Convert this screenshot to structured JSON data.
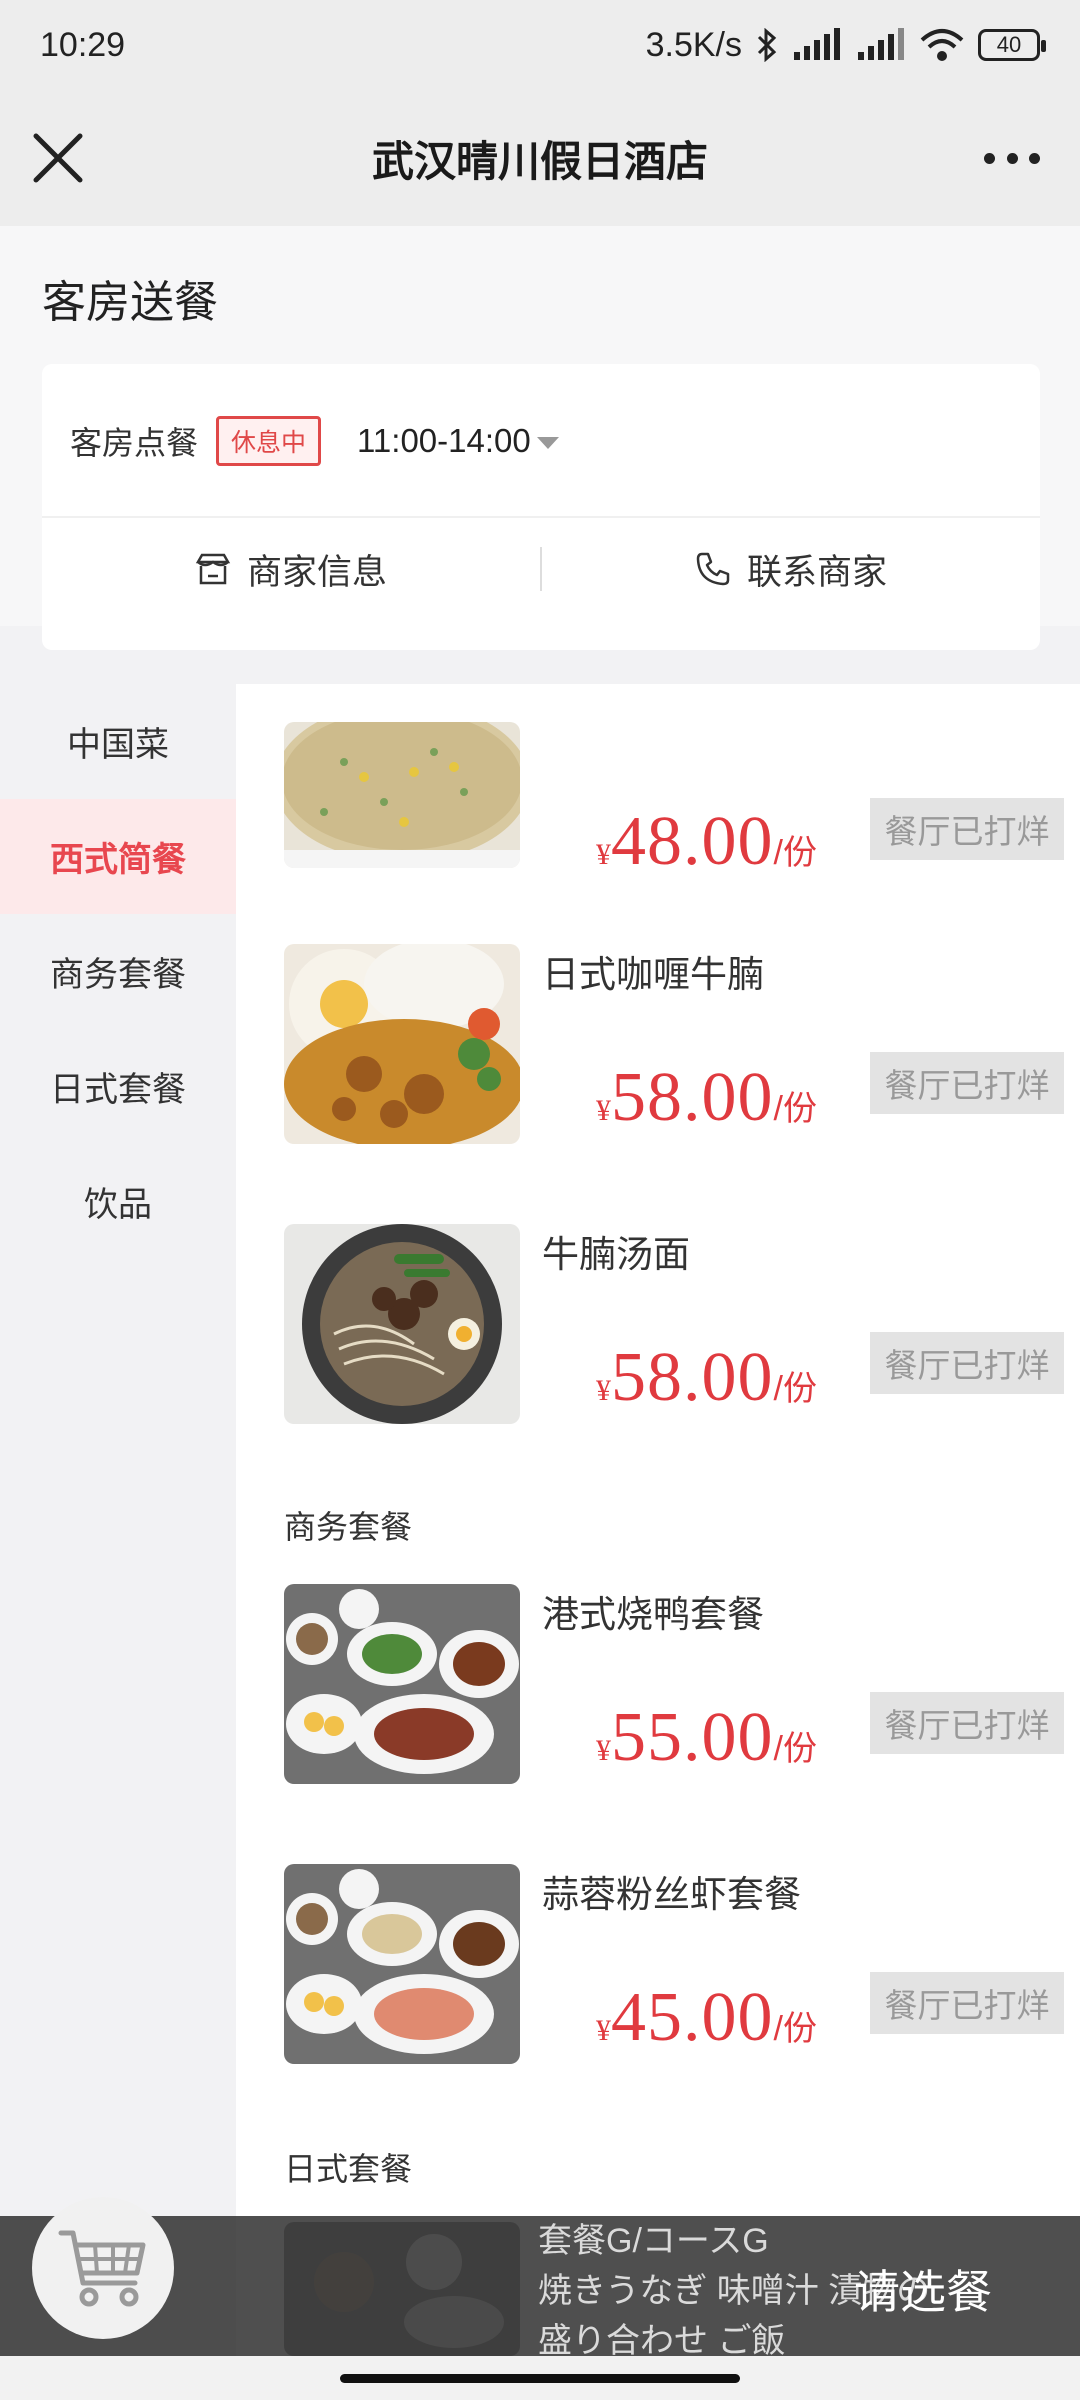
{
  "status_bar": {
    "time": "10:29",
    "net_speed": "3.5K/s",
    "battery": "40"
  },
  "nav": {
    "title": "武汉晴川假日酒店"
  },
  "header": {
    "section_title": "客房送餐",
    "service_name": "客房点餐",
    "status_tag": "休息中",
    "hours": "11:00-14:00",
    "merchant_info_label": "商家信息",
    "contact_label": "联系商家"
  },
  "categories": [
    {
      "label": "中国菜",
      "active": false
    },
    {
      "label": "西式简餐",
      "active": true
    },
    {
      "label": "商务套餐",
      "active": false
    },
    {
      "label": "日式套餐",
      "active": false
    },
    {
      "label": "饮品",
      "active": false
    }
  ],
  "items": [
    {
      "name": "",
      "price_symbol": "¥",
      "price": "48.00",
      "unit": "/份",
      "status": "餐厅已打烊"
    },
    {
      "name": "日式咖喱牛腩",
      "price_symbol": "¥",
      "price": "58.00",
      "unit": "/份",
      "status": "餐厅已打烊"
    },
    {
      "name": "牛腩汤面",
      "price_symbol": "¥",
      "price": "58.00",
      "unit": "/份",
      "status": "餐厅已打烊"
    },
    {
      "name": "港式烧鸭套餐",
      "price_symbol": "¥",
      "price": "55.00",
      "unit": "/份",
      "status": "餐厅已打烊"
    },
    {
      "name": "蒜蓉粉丝虾套餐",
      "price_symbol": "¥",
      "price": "45.00",
      "unit": "/份",
      "status": "餐厅已打烊"
    }
  ],
  "groups": {
    "business": "商务套餐",
    "japanese": "日式套餐"
  },
  "peek_item": {
    "line1": "套餐G/コースG",
    "line2": "焼きうなぎ 味噌汁 漬物の",
    "line3": "盛り合わせ ご飯"
  },
  "cart": {
    "label": "请选餐"
  },
  "colors": {
    "accent": "#e8474f",
    "price": "#e03a3f"
  }
}
